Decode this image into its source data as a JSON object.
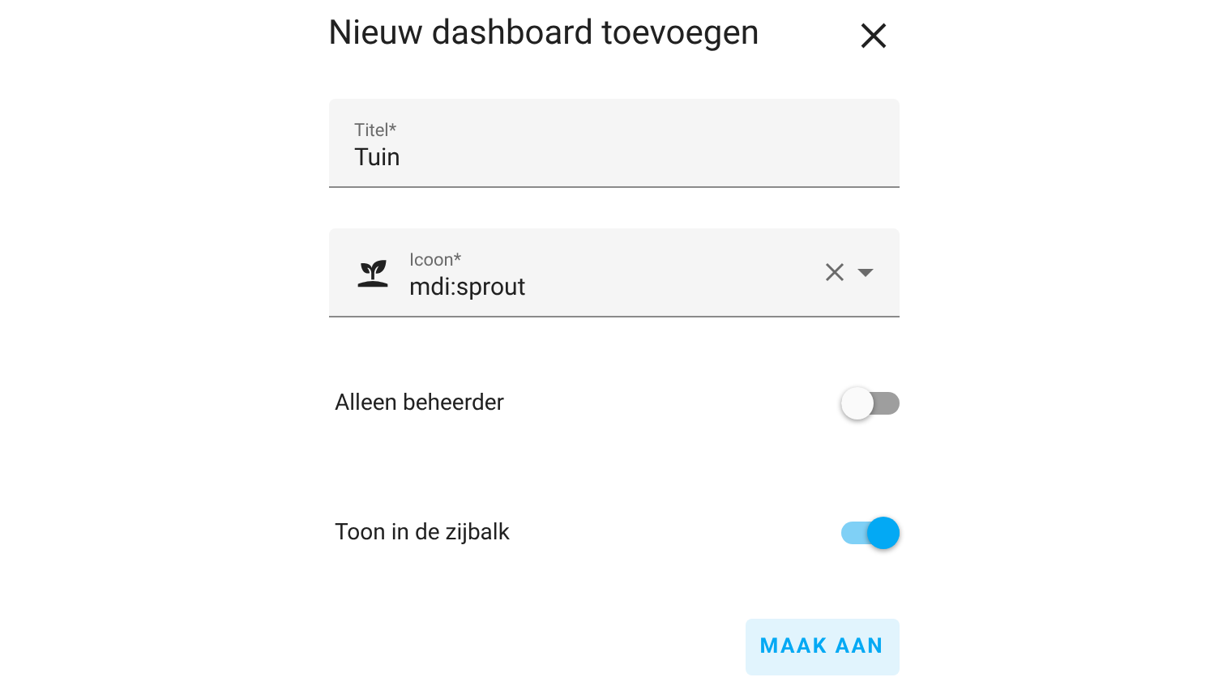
{
  "dialog": {
    "title": "Nieuw dashboard toevoegen",
    "fields": [
      {
        "kind": "text",
        "label": "Titel*",
        "value": "Tuin"
      },
      {
        "kind": "icon",
        "label": "Icoon*",
        "value": "mdi:sprout"
      }
    ],
    "toggles": [
      {
        "label": "Alleen beheerder",
        "on": false
      },
      {
        "label": "Toon in de zijbalk",
        "on": true
      }
    ],
    "button": "MAAK AAN"
  }
}
